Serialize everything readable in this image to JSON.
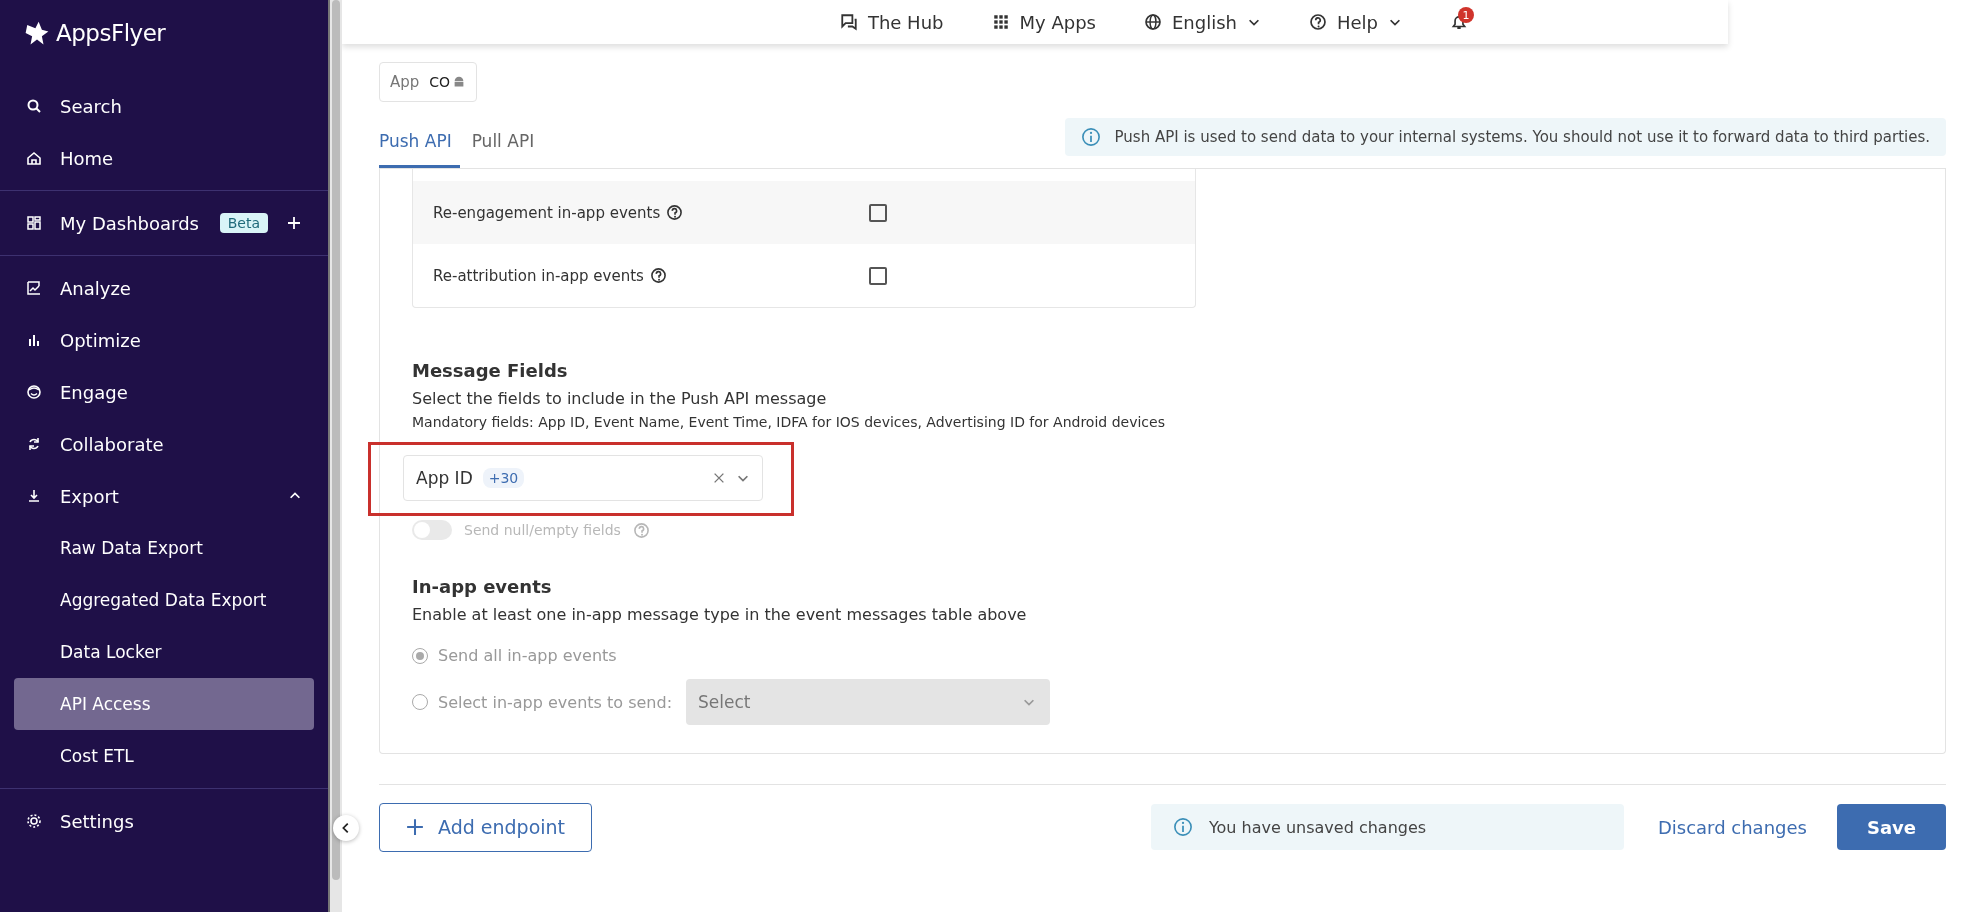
{
  "sidebar": {
    "logo": "AppsFlyer",
    "sections": [
      [
        {
          "label": "Search"
        },
        {
          "label": "Home"
        }
      ],
      [
        {
          "label": "My Dashboards",
          "badge": "Beta"
        }
      ],
      [
        {
          "label": "Analyze"
        },
        {
          "label": "Optimize"
        },
        {
          "label": "Engage"
        },
        {
          "label": "Collaborate"
        },
        {
          "label": "Export",
          "expanded": true,
          "children": [
            {
              "label": "Raw Data Export",
              "selected": false
            },
            {
              "label": "Aggregated Data Export",
              "selected": false
            },
            {
              "label": "Data Locker",
              "selected": false
            },
            {
              "label": "API Access",
              "selected": true
            },
            {
              "label": "Cost ETL",
              "selected": false
            }
          ]
        }
      ],
      [
        {
          "label": "Settings"
        }
      ]
    ]
  },
  "topbar": {
    "items": [
      {
        "label": "The Hub",
        "kind": "link"
      },
      {
        "label": "My Apps",
        "kind": "link"
      },
      {
        "label": "English",
        "kind": "dropdown"
      },
      {
        "label": "Help",
        "kind": "dropdown"
      }
    ],
    "notifications": "1"
  },
  "app_chip": {
    "label": "App",
    "value": "CO"
  },
  "tabs": [
    {
      "label": "Push API",
      "selected": true
    },
    {
      "label": "Pull API",
      "selected": false
    }
  ],
  "info_banner": "Push API is used to send data to your internal systems. You should not use it to forward data to third parties.",
  "event_rows": [
    {
      "label": "Re-engagement in-app events",
      "checked": false
    },
    {
      "label": "Re-attribution in-app events",
      "checked": false
    }
  ],
  "message_fields": {
    "title": "Message Fields",
    "description": "Select the fields to include in the Push API message",
    "note": "Mandatory fields: App ID, Event Name, Event Time, IDFA for IOS devices, Advertising ID for Android devices",
    "select": {
      "value": "App ID",
      "more": "+30"
    },
    "toggle": {
      "label": "Send null/empty fields",
      "on": false,
      "disabled": true
    }
  },
  "in_app_events": {
    "title": "In-app events",
    "description": "Enable at least one in-app message type in the event messages table above",
    "options": [
      {
        "label": "Send all in-app events",
        "selected": true,
        "disabled": true
      },
      {
        "label": "Select in-app events to send:",
        "selected": false,
        "disabled": true,
        "select_placeholder": "Select"
      }
    ]
  },
  "footer": {
    "add_button": "Add endpoint",
    "notice": "You have unsaved changes",
    "discard": "Discard changes",
    "save": "Save"
  }
}
